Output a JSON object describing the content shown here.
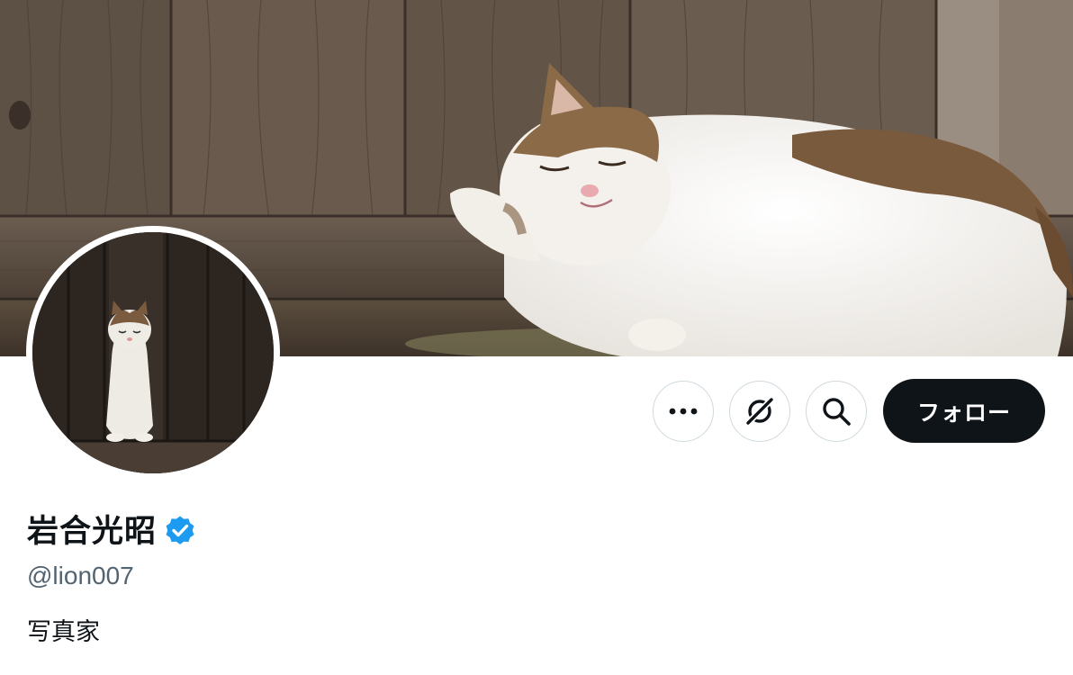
{
  "profile": {
    "display_name": "岩合光昭",
    "handle": "@lion007",
    "bio": "写真家",
    "verified": true
  },
  "actions": {
    "more_icon": "more-horizontal-icon",
    "grok_icon": "grok-icon",
    "search_icon": "search-icon",
    "follow_label": "フォロー"
  },
  "images": {
    "banner": "cat-sleeping-banner",
    "avatar": "cat-sitting-avatar"
  },
  "colors": {
    "follow_bg": "#0f1419",
    "verified": "#1d9bf0",
    "handle": "#536471",
    "border": "#cfd9de"
  }
}
